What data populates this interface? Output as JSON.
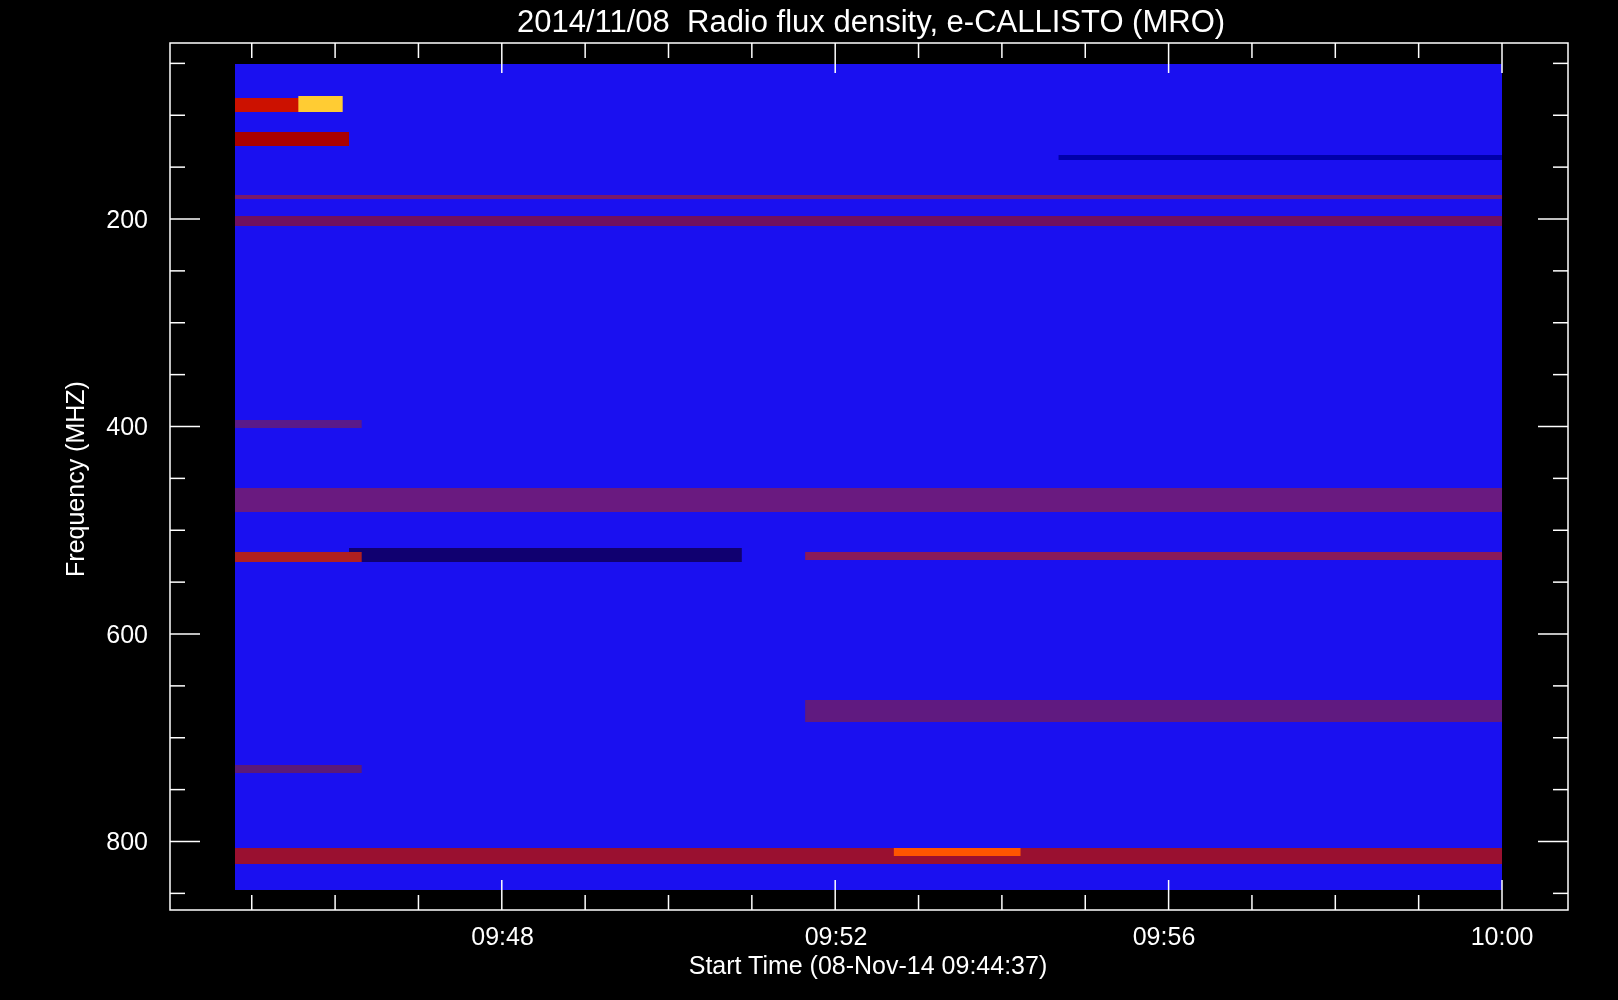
{
  "title": "2014/11/08  Radio flux density, e-CALLISTO (MRO)",
  "y_axis": {
    "label": "Frequency (MHZ)",
    "ticks": [
      "200",
      "400",
      "600",
      "800"
    ]
  },
  "x_axis": {
    "label": "Start Time (08-Nov-14 09:44:37)",
    "ticks": [
      "09:48",
      "09:52",
      "09:56",
      "10:00"
    ]
  }
}
